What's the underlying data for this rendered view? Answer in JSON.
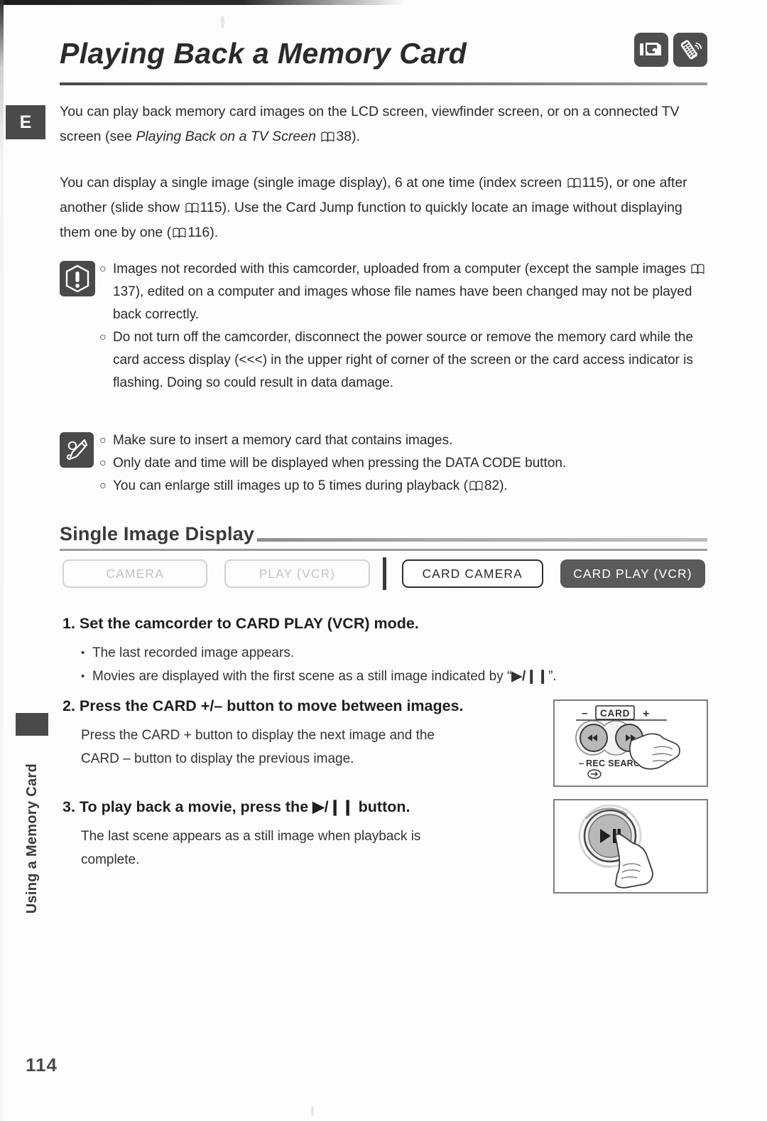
{
  "document": {
    "page_number": "114",
    "language_tab": "E",
    "side_tab_label": "Using a Memory Card",
    "title": "Playing Back a Memory Card",
    "header_icons": [
      "camcorder-icon",
      "remote-control-icon"
    ]
  },
  "intro": {
    "paragraph1_part1": "You can play back memory card images on the LCD screen, viewfinder screen, or on a connected TV screen (see ",
    "paragraph1_italic": "Playing Back on a TV Screen",
    "paragraph1_ref": "38",
    "paragraph1_part2": ").",
    "paragraph2_part1": "You can display a single image (single image display), 6 at one time (index screen ",
    "paragraph2_ref1": "115",
    "paragraph2_part2": "), or one after another (slide show ",
    "paragraph2_ref2": "115",
    "paragraph2_part3": "). Use the Card Jump function to quickly locate an image without displaying them one by one (",
    "paragraph2_ref3": "116",
    "paragraph2_part4": ")."
  },
  "caution": {
    "icon": "caution-exclamation-icon",
    "items": [
      {
        "text_part1": "Images not recorded with this camcorder, uploaded from a computer (except the sample images ",
        "ref": "137",
        "text_part2": "), edited on a computer and images whose file names have been changed may not be played back correctly."
      },
      {
        "text_part1": "Do not turn off the camcorder, disconnect the power source or remove the memory card while the card access display (<<<) in the upper right of corner of the screen or the card access indicator is flashing. Doing so could result in data damage.",
        "ref": "",
        "text_part2": ""
      }
    ]
  },
  "notes": {
    "icon": "pencil-note-icon",
    "items": [
      {
        "text_part1": "Make sure to insert a memory card that contains images.",
        "ref": "",
        "text_part2": ""
      },
      {
        "text_part1": "Only date and time will be displayed when pressing the DATA CODE button.",
        "ref": "",
        "text_part2": ""
      },
      {
        "text_part1": "You can enlarge still images up to 5 times during playback (",
        "ref": "82",
        "text_part2": ")."
      }
    ]
  },
  "section": {
    "heading": "Single Image Display",
    "modes": [
      {
        "label": "CAMERA",
        "state": "disabled"
      },
      {
        "label": "PLAY (VCR)",
        "state": "disabled"
      },
      {
        "label": "CARD CAMERA",
        "state": "available"
      },
      {
        "label": "CARD PLAY (VCR)",
        "state": "active"
      }
    ]
  },
  "steps": [
    {
      "number": "1.",
      "title": "Set the camcorder to CARD PLAY (VCR) mode.",
      "bullets": [
        {
          "pre": "The last recorded image appears.",
          "glyph": "",
          "post": ""
        },
        {
          "pre": "Movies are displayed with the first scene as a still image indicated by “",
          "glyph": "▶/❙❙",
          "post": "”."
        }
      ],
      "body_lines": []
    },
    {
      "number": "2.",
      "title": "Press the CARD +/– button to move between images.",
      "bullets": [],
      "body_lines": [
        "Press the CARD + button to display the next image and the",
        "CARD – button to display the previous image."
      ]
    },
    {
      "number": "3.",
      "title_pre": "To play back a movie, press the ",
      "title_glyph": "▶/❙❙",
      "title_post": " button.",
      "title": "To play back a movie, press the ▶/❙❙ button.",
      "bullets": [],
      "body_lines": [
        "The last scene appears as a still image when playback is",
        "complete."
      ]
    }
  ],
  "illustrations": [
    {
      "name": "card-plus-minus-buttons",
      "labels": {
        "minus": "–",
        "card": "CARD",
        "plus": "+",
        "rec_search_minus": "–",
        "rec_search": "REC SEARCH",
        "rec_search_plus": "+",
        "left_button": "◀◀",
        "right_button": "▶▶"
      }
    },
    {
      "name": "play-pause-button",
      "labels": {
        "button": "▶/❙❙"
      }
    }
  ],
  "colors": {
    "ink": "#2a2a2a",
    "badge": "#4a4a4a",
    "active_pill": "#5a5a5a",
    "disabled_text": "#c3c3c3",
    "rule": "#9c9c9c"
  }
}
